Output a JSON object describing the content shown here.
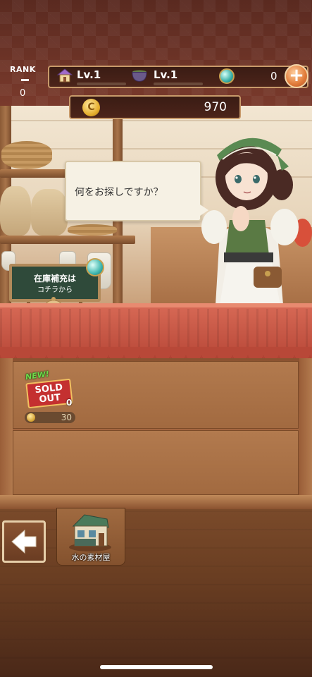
{
  "hud": {
    "rank_label": "RANK",
    "rank_value": "0",
    "shop_level": "Lv.1",
    "cauldron_level": "Lv.1",
    "gem_count": "0",
    "add_button_symbol": "+",
    "coin_symbol": "C",
    "coins": "970"
  },
  "dialog": {
    "text": "何をお探しですか？"
  },
  "restock_sign": {
    "line1": "在庫補充は",
    "line2": "コチラから"
  },
  "shelf": {
    "items": [
      {
        "new_label": "NEW!",
        "status_line1": "SOLD",
        "status_line2": "OUT",
        "stock": "0",
        "price": "30"
      }
    ]
  },
  "nav": {
    "back_icon": "left-arrow-icon",
    "shop_tab_label": "水の素材屋"
  },
  "colors": {
    "awning": "#c45442",
    "counter": "#a46640",
    "hud_border": "#c89a6a",
    "sold_out": "#c43030",
    "new_tag": "#6ed84a"
  }
}
